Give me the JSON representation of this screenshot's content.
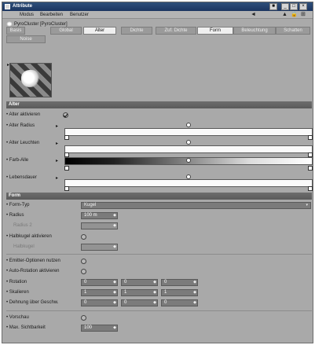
{
  "window": {
    "title": "Attribute"
  },
  "titlebar_buttons": {
    "pin": "■",
    "minimize": "_",
    "maximize": "□",
    "close": "×"
  },
  "menu": {
    "items": [
      "Modus",
      "Bearbeiten",
      "Benutzer"
    ]
  },
  "toolbar": {
    "back": "◄",
    "up": "▲",
    "lock": "🔒",
    "new": "⊞"
  },
  "object": {
    "title": "PyroCluster [PyroCluster]"
  },
  "tabs": [
    "Basis",
    "Global",
    "Alter",
    "Dichte",
    "Zuf. Dichte",
    "Form",
    "Beleuchtung",
    "Schatten",
    "Noise"
  ],
  "active_tab": "Alter",
  "sections": {
    "alter": "Alter",
    "form": "Form"
  },
  "alter": {
    "aktivieren": "Alter aktivieren",
    "radius": "Alter Radius",
    "leuchten": "Alter Leuchten",
    "farbe": "Farb-Alle",
    "lebensdauer": "Lebensdauer",
    "aktivieren_checked": true
  },
  "form": {
    "form_typ_label": "Form-Typ",
    "form_typ_value": "Kugel",
    "radius_label": "Radius",
    "radius_value": "100 m",
    "radius2_label": "Radius 2",
    "halbkugel_label": "Halbkugel aktivieren",
    "halbkugel_aktivieren": false,
    "halbkugel_label2": "Halbkugel",
    "emitter_label": "Emitter-Optionen nutzen",
    "emitter_optionen": false,
    "auto_rotation_label": "Auto-Rotation aktivieren",
    "auto_rotation": false,
    "rotation_label": "Rotation",
    "skalieren_label": "Skalieren",
    "dehnung_label": "Dehnung über Geschw.",
    "rotation_values": [
      "0",
      "0",
      "0"
    ],
    "skalieren_values": [
      "1",
      "1",
      "1"
    ],
    "dehnung_values": [
      "0",
      "0",
      "0"
    ],
    "vorschau_label": "Vorschau",
    "vorschau": false,
    "max_sichtbarkeit_label": "Max. Sichtbarkeit",
    "max_sichtbarkeit_value": "100"
  },
  "glyphs": {
    "arrow_right": "▸",
    "bullet": "•",
    "spin": "◆",
    "caret": "▾",
    "dropdown_arrow": "▾"
  }
}
